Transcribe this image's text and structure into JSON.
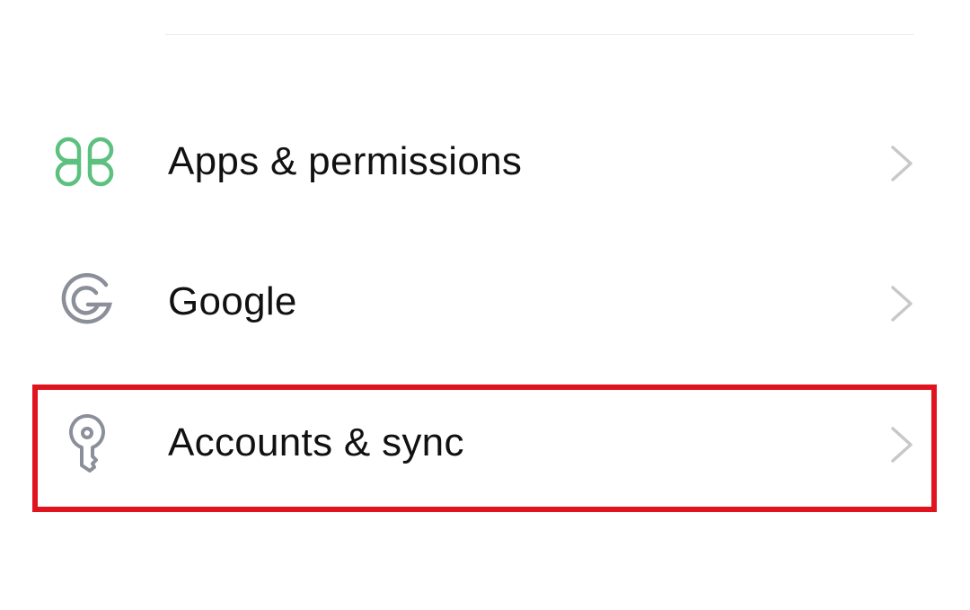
{
  "settings": {
    "items": [
      {
        "label": "Apps & permissions",
        "icon": "apps-grid-icon",
        "icon_color": "#5cc07e"
      },
      {
        "label": "Google",
        "icon": "google-g-icon",
        "icon_color": "#8a8f99"
      },
      {
        "label": "Accounts & sync",
        "icon": "key-icon",
        "icon_color": "#8a8f99"
      }
    ],
    "chevron_color": "#c8c8c8",
    "highlight_color": "#e0141f",
    "highlighted_item": "Accounts & sync"
  }
}
